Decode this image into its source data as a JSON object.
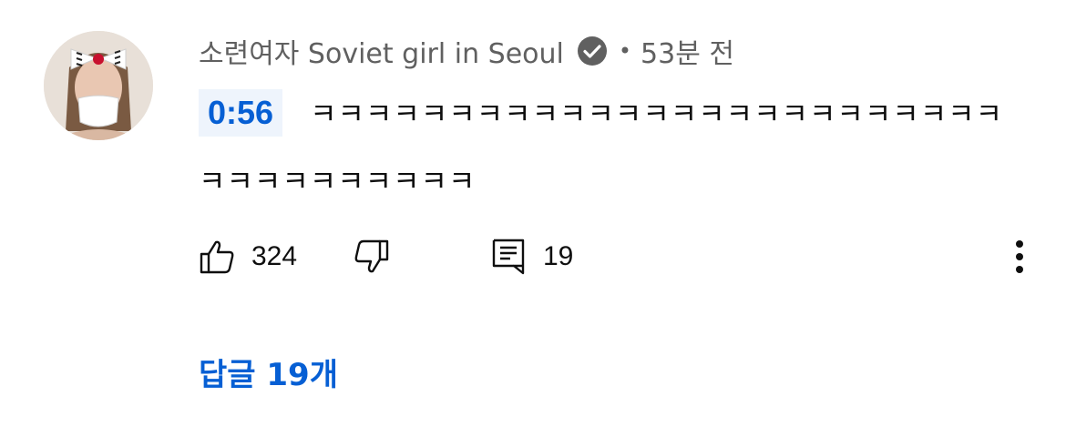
{
  "comment": {
    "author": "소련여자 Soviet girl in Seoul",
    "separator": "•",
    "posted": "53분 전",
    "timestamp_link": "0:56",
    "text": "ㅋㅋㅋㅋㅋㅋㅋㅋㅋㅋㅋㅋㅋㅋㅋㅋㅋㅋㅋㅋㅋㅋㅋㅋㅋㅋㅋㅋㅋㅋㅋㅋㅋㅋㅋ",
    "likes": "324",
    "reply_count": "19",
    "replies_link": "답글 19개"
  },
  "icons": {
    "avatar": "avatar-image",
    "verified": "verified-check-icon",
    "like": "thumbs-up-icon",
    "dislike": "thumbs-down-icon",
    "reply": "comment-reply-icon",
    "more": "more-vertical-icon"
  },
  "colors": {
    "link_blue": "#065fd4",
    "timestamp_bg": "#eef4fc",
    "meta_gray": "#606060",
    "text": "#0f0f0f"
  }
}
